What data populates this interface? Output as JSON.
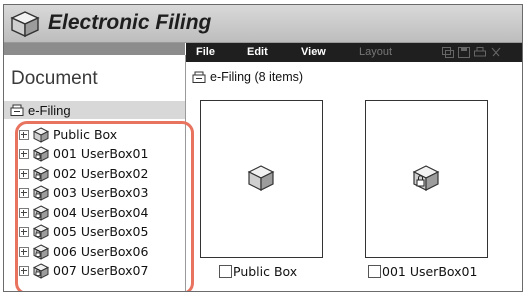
{
  "app": {
    "title": "Electronic Filing"
  },
  "menu": {
    "file": "File",
    "edit": "Edit",
    "view": "View",
    "layout": "Layout"
  },
  "left": {
    "heading": "Document",
    "root_label": "e-Filing",
    "items": [
      {
        "label": "Public Box",
        "icon": "public-box-icon"
      },
      {
        "label": "001 UserBox01",
        "icon": "locked-box-icon"
      },
      {
        "label": "002 UserBox02",
        "icon": "locked-box-icon"
      },
      {
        "label": "003 UserBox03",
        "icon": "locked-box-icon"
      },
      {
        "label": "004 UserBox04",
        "icon": "locked-box-icon"
      },
      {
        "label": "005 UserBox05",
        "icon": "locked-box-icon"
      },
      {
        "label": "006 UserBox06",
        "icon": "locked-box-icon"
      },
      {
        "label": "007 UserBox07",
        "icon": "locked-box-icon"
      }
    ]
  },
  "main": {
    "breadcrumb": "e-Filing  (8 items)",
    "cards": [
      {
        "label": "Public Box",
        "icon": "public-box-icon"
      },
      {
        "label": "001 UserBox01",
        "icon": "locked-box-icon"
      }
    ]
  },
  "colors": {
    "highlight": "#e8735f",
    "menubar": "#1f1f1f",
    "titlebar": "#c8c8c8"
  }
}
